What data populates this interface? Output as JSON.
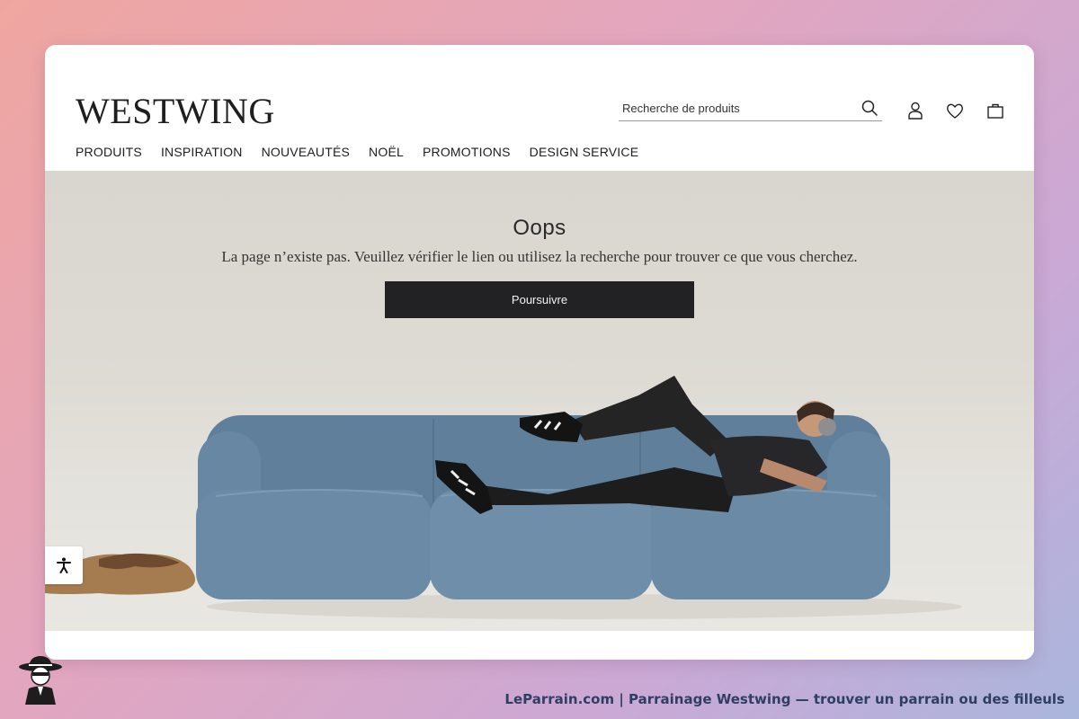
{
  "brand": {
    "logo_text": "WESTWING"
  },
  "search": {
    "placeholder": "Recherche de produits"
  },
  "header_icons": [
    "search-icon",
    "user-icon",
    "heart-icon",
    "bag-icon"
  ],
  "nav": {
    "items": [
      {
        "label": "PRODUITS"
      },
      {
        "label": "INSPIRATION"
      },
      {
        "label": "NOUVEAUTÉS"
      },
      {
        "label": "NOËL"
      },
      {
        "label": "PROMOTIONS"
      },
      {
        "label": "DESIGN SERVICE"
      }
    ]
  },
  "hero": {
    "title": "Oops",
    "message": "La page n’existe pas. Veuillez vérifier le lien ou utilisez la recherche pour trouver ce que vous cherchez.",
    "button_label": "Poursuivre"
  },
  "accessibility": {
    "icon": "accessibility-icon"
  },
  "watermark": {
    "caption": "LeParrain.com | Parrainage Westwing — trouver un parrain ou des filleuls"
  },
  "colors": {
    "button_bg": "#222224",
    "sofa": "#6b8aa6",
    "hero_bg": "#dcdad3",
    "caption": "#2f3f63"
  }
}
